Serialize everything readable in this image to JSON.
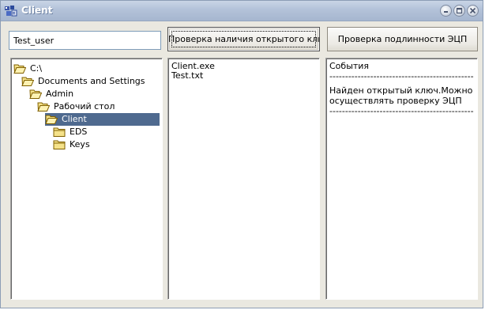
{
  "window": {
    "title": "Client"
  },
  "controls": {
    "username_value": "Test_user",
    "check_key_button": "Проверка наличия открытого ключа",
    "verify_button": "Проверка подлинности ЭЦП"
  },
  "tree": {
    "items": [
      {
        "label": "C:\\",
        "depth": 0,
        "open": true,
        "selected": false
      },
      {
        "label": "Documents and Settings",
        "depth": 1,
        "open": true,
        "selected": false
      },
      {
        "label": "Admin",
        "depth": 2,
        "open": true,
        "selected": false
      },
      {
        "label": "Рабочий стол",
        "depth": 3,
        "open": true,
        "selected": false
      },
      {
        "label": "Client",
        "depth": 4,
        "open": true,
        "selected": true
      },
      {
        "label": "EDS",
        "depth": 5,
        "open": false,
        "selected": false
      },
      {
        "label": "Keys",
        "depth": 5,
        "open": false,
        "selected": false
      }
    ]
  },
  "files": {
    "items": [
      "Client.exe",
      "Test.txt"
    ]
  },
  "events": {
    "lines": [
      "События",
      "----------------------------------------------------",
      "",
      "Найден открытый ключ.Можно",
      "осуществлять проверку ЭЦП",
      "----------------------------------------------------"
    ]
  },
  "colors": {
    "selection": "#4f6a8f",
    "folder_fill": "#f5e28a",
    "folder_outline": "#806000"
  },
  "icons": {
    "app": "app-icon",
    "minimize": "minimize-icon",
    "maximize": "maximize-icon",
    "close": "close-icon",
    "folder_open": "open-folder-icon",
    "folder_closed": "folder-icon"
  }
}
